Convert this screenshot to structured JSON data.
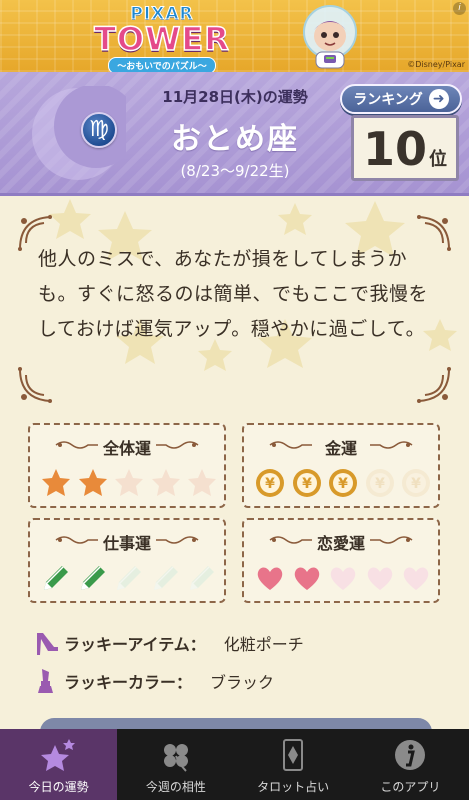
{
  "banner": {
    "logo_top": "PIXAR",
    "logo_main": "TOWER",
    "logo_sub": "〜おもいでのパズル〜",
    "copyright": "©Disney/Pixar",
    "info": "i"
  },
  "header": {
    "date": "11月28日(木)の運勢",
    "sign": "おとめ座",
    "sign_symbol": "♍",
    "range": "(8/23〜9/22生)",
    "ranking_button": "ランキング",
    "rank_number": "10",
    "rank_unit": "位"
  },
  "message": "他人のミスで、あなたが損をしてしまうかも。すぐに怒るのは簡単、でもここで我慢をしておけば運気アップ。穏やかに過ごして。",
  "fortunes": [
    {
      "title": "全体運",
      "icon": "star-icon",
      "score": 2,
      "max": 5,
      "color": "#e88a3a"
    },
    {
      "title": "金運",
      "icon": "yen-coin-icon",
      "score": 3,
      "max": 5,
      "color": "#d89a2a"
    },
    {
      "title": "仕事運",
      "icon": "pencil-icon",
      "score": 2,
      "max": 5,
      "color": "#3a9a4a"
    },
    {
      "title": "恋愛運",
      "icon": "heart-icon",
      "score": 2,
      "max": 5,
      "color": "#e8748a"
    }
  ],
  "lucky": {
    "item_label": "ラッキーアイテム：",
    "item_value": "化粧ポーチ",
    "color_label": "ラッキーカラー：",
    "color_value": "ブラック"
  },
  "tabs": [
    {
      "label": "今日の運勢",
      "icon": "stars-icon",
      "active": true
    },
    {
      "label": "今週の相性",
      "icon": "clover-icon",
      "active": false
    },
    {
      "label": "タロット占い",
      "icon": "tarot-card-icon",
      "active": false
    },
    {
      "label": "このアプリ",
      "icon": "info-icon",
      "active": false
    }
  ]
}
